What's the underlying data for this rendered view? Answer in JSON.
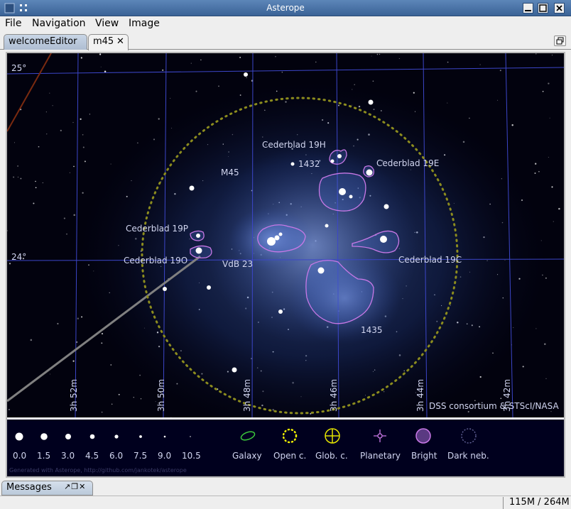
{
  "window": {
    "title": "Asterope"
  },
  "menu": [
    "File",
    "Navigation",
    "View",
    "Image"
  ],
  "tabs": [
    {
      "label": "welcomeEditor"
    },
    {
      "label": "m45"
    }
  ],
  "tab_close": "✕",
  "map": {
    "dec_labels": [
      "25°",
      "24°"
    ],
    "ra_labels": [
      "3h 52m",
      "3h 50m",
      "3h 48m",
      "3h 46m",
      "3h 44m",
      "3h 42m"
    ],
    "object_labels": {
      "cederblad_19h": "Cederblad 19H",
      "n1432": "1432",
      "cederblad_19e": "Cederblad 19E",
      "m45": "M45",
      "cederblad_19p": "Cederblad 19P",
      "cederblad_19o": "Cederblad 19O",
      "vdb23": "VdB 23",
      "cederblad_19c": "Cederblad 19C",
      "n1435": "1435"
    },
    "credit": "DSS consortium & STScI/NASA"
  },
  "legend": {
    "magnitudes": [
      "0.0",
      "1.5",
      "3.0",
      "4.5",
      "6.0",
      "7.5",
      "9.0",
      "10.5"
    ],
    "types": [
      "Galaxy",
      "Open c.",
      "Glob. c.",
      "Planetary",
      "Bright",
      "Dark neb."
    ],
    "footer": "Generated with Asterope, http://github.com/jankotek/asterope"
  },
  "messages": {
    "label": "Messages"
  },
  "status": {
    "memory": "115M / 264M"
  },
  "colors": {
    "accent": "#3a6396",
    "sky": "#02020e",
    "grid": "#3c46c8",
    "nebula_outline": "#c878e6",
    "cluster_circle": "#8c8c1e"
  }
}
